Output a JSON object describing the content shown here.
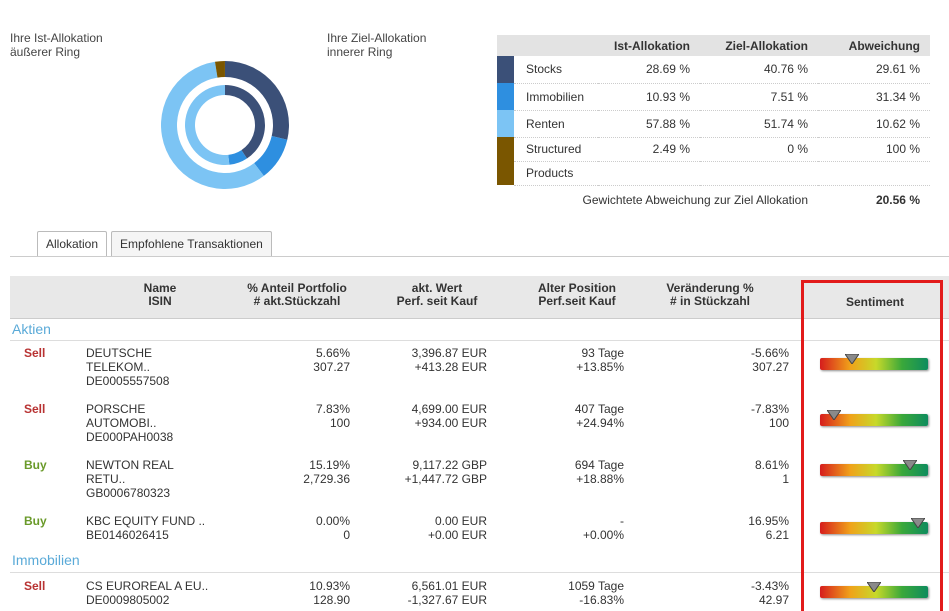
{
  "overview": {
    "ist_label_line1": "Ihre Ist-Allokation",
    "ist_label_line2": "äußerer Ring",
    "ziel_label_line1": "Ihre Ziel-Allokation",
    "ziel_label_line2": "innerer Ring",
    "table_headers": [
      "Ist-Allokation",
      "Ziel-Allokation",
      "Abweichung"
    ],
    "rows": [
      {
        "name": "Stocks",
        "ist": "28.69 %",
        "ziel": "40.76 %",
        "abw": "29.61 %",
        "color": "#3b5078",
        "ist_value": 28.69,
        "ziel_value": 40.76
      },
      {
        "name": "Immobilien",
        "ist": "10.93 %",
        "ziel": "7.51 %",
        "abw": "31.34 %",
        "color": "#2e8fe0",
        "ist_value": 10.93,
        "ziel_value": 7.51
      },
      {
        "name": "Renten",
        "ist": "57.88 %",
        "ziel": "51.74 %",
        "abw": "10.62 %",
        "color": "#7cc4f4",
        "ist_value": 57.88,
        "ziel_value": 51.74
      },
      {
        "name_line1": "Structured",
        "name_line2": "Products",
        "ist": "2.49 %",
        "ziel": "0 %",
        "abw": "100 %",
        "color": "#7a5600",
        "ist_value": 2.49,
        "ziel_value": 0
      }
    ],
    "weighted_label": "Gewichtete Abweichung zur Ziel Allokation",
    "weighted_value": "20.56 %"
  },
  "tabs": [
    {
      "label": "Allokation"
    },
    {
      "label": "Empfohlene Transaktionen"
    }
  ],
  "transactions": {
    "headers": {
      "name_1": "Name",
      "name_2": "ISIN",
      "anteil_1": "% Anteil Portfolio",
      "anteil_2": "# akt.Stückzahl",
      "wert_1": "akt. Wert",
      "wert_2": "Perf. seit Kauf",
      "alter_1": "Alter Position",
      "alter_2": "Perf.seit Kauf",
      "veraend_1": "Veränderung %",
      "veraend_2": "# in Stückzahl",
      "sentiment": "Sentiment"
    },
    "sections": {
      "aktien": "Aktien",
      "immobilien": "Immobilien"
    },
    "rows": [
      {
        "action": "Sell",
        "name_1": "DEUTSCHE",
        "name_2": "TELEKOM..",
        "isin": "DE0005557508",
        "anteil": "5.66%",
        "stueck": "307.27",
        "wert": "3,396.87 EUR",
        "perf": "+413.28 EUR",
        "alter": "93 Tage",
        "perf_kauf": "+13.85%",
        "veraend": "-5.66%",
        "veraend_stueck": "307.27",
        "sentiment_level": 0.3
      },
      {
        "action": "Sell",
        "name_1": "PORSCHE",
        "name_2": "AUTOMOBI..",
        "isin": "DE000PAH0038",
        "anteil": "7.83%",
        "stueck": "100",
        "wert": "4,699.00 EUR",
        "perf": "+934.00 EUR",
        "alter": "407 Tage",
        "perf_kauf": "+24.94%",
        "veraend": "-7.83%",
        "veraend_stueck": "100",
        "sentiment_level": 0.13
      },
      {
        "action": "Buy",
        "name_1": "NEWTON REAL",
        "name_2": "RETU..",
        "isin": "GB0006780323",
        "anteil": "15.19%",
        "stueck": "2,729.36",
        "wert": "9,117.22 GBP",
        "perf": "+1,447.72 GBP",
        "alter": "694 Tage",
        "perf_kauf": "+18.88%",
        "veraend": "8.61%",
        "veraend_stueck": "1",
        "sentiment_level": 0.83
      },
      {
        "action": "Buy",
        "name_1": "KBC EQUITY FUND ..",
        "isin_inline": "BE0146026415",
        "anteil": "0.00%",
        "stueck": "0",
        "wert": "0.00 EUR",
        "perf": "+0.00 EUR",
        "alter": "-",
        "perf_kauf": "+0.00%",
        "veraend": "16.95%",
        "veraend_stueck": "6.21",
        "sentiment_level": 0.91
      },
      {
        "action": "Sell",
        "name_1": "CS EUROREAL A EU..",
        "isin_inline": "DE0009805002",
        "anteil": "10.93%",
        "stueck": "128.90",
        "wert": "6,561.01 EUR",
        "perf": "-1,327.67 EUR",
        "alter": "1059 Tage",
        "perf_kauf": "-16.83%",
        "veraend": "-3.43%",
        "veraend_stueck": "42.97",
        "sentiment_level": 0.5
      }
    ]
  }
}
